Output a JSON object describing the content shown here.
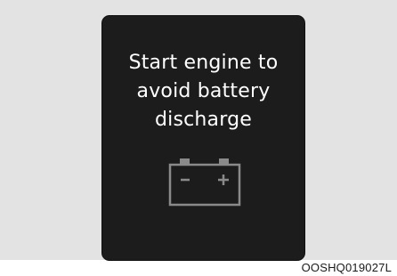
{
  "display": {
    "message_lines": [
      "Start engine to",
      "avoid battery",
      "discharge"
    ],
    "icon": "battery-icon"
  },
  "figure": {
    "code": "OOSHQ019027L"
  },
  "colors": {
    "panel_background": "#1c1c1c",
    "message_text": "#ffffff",
    "icon_stroke": "#8a8a8a",
    "backdrop": "#e3e3e3"
  }
}
